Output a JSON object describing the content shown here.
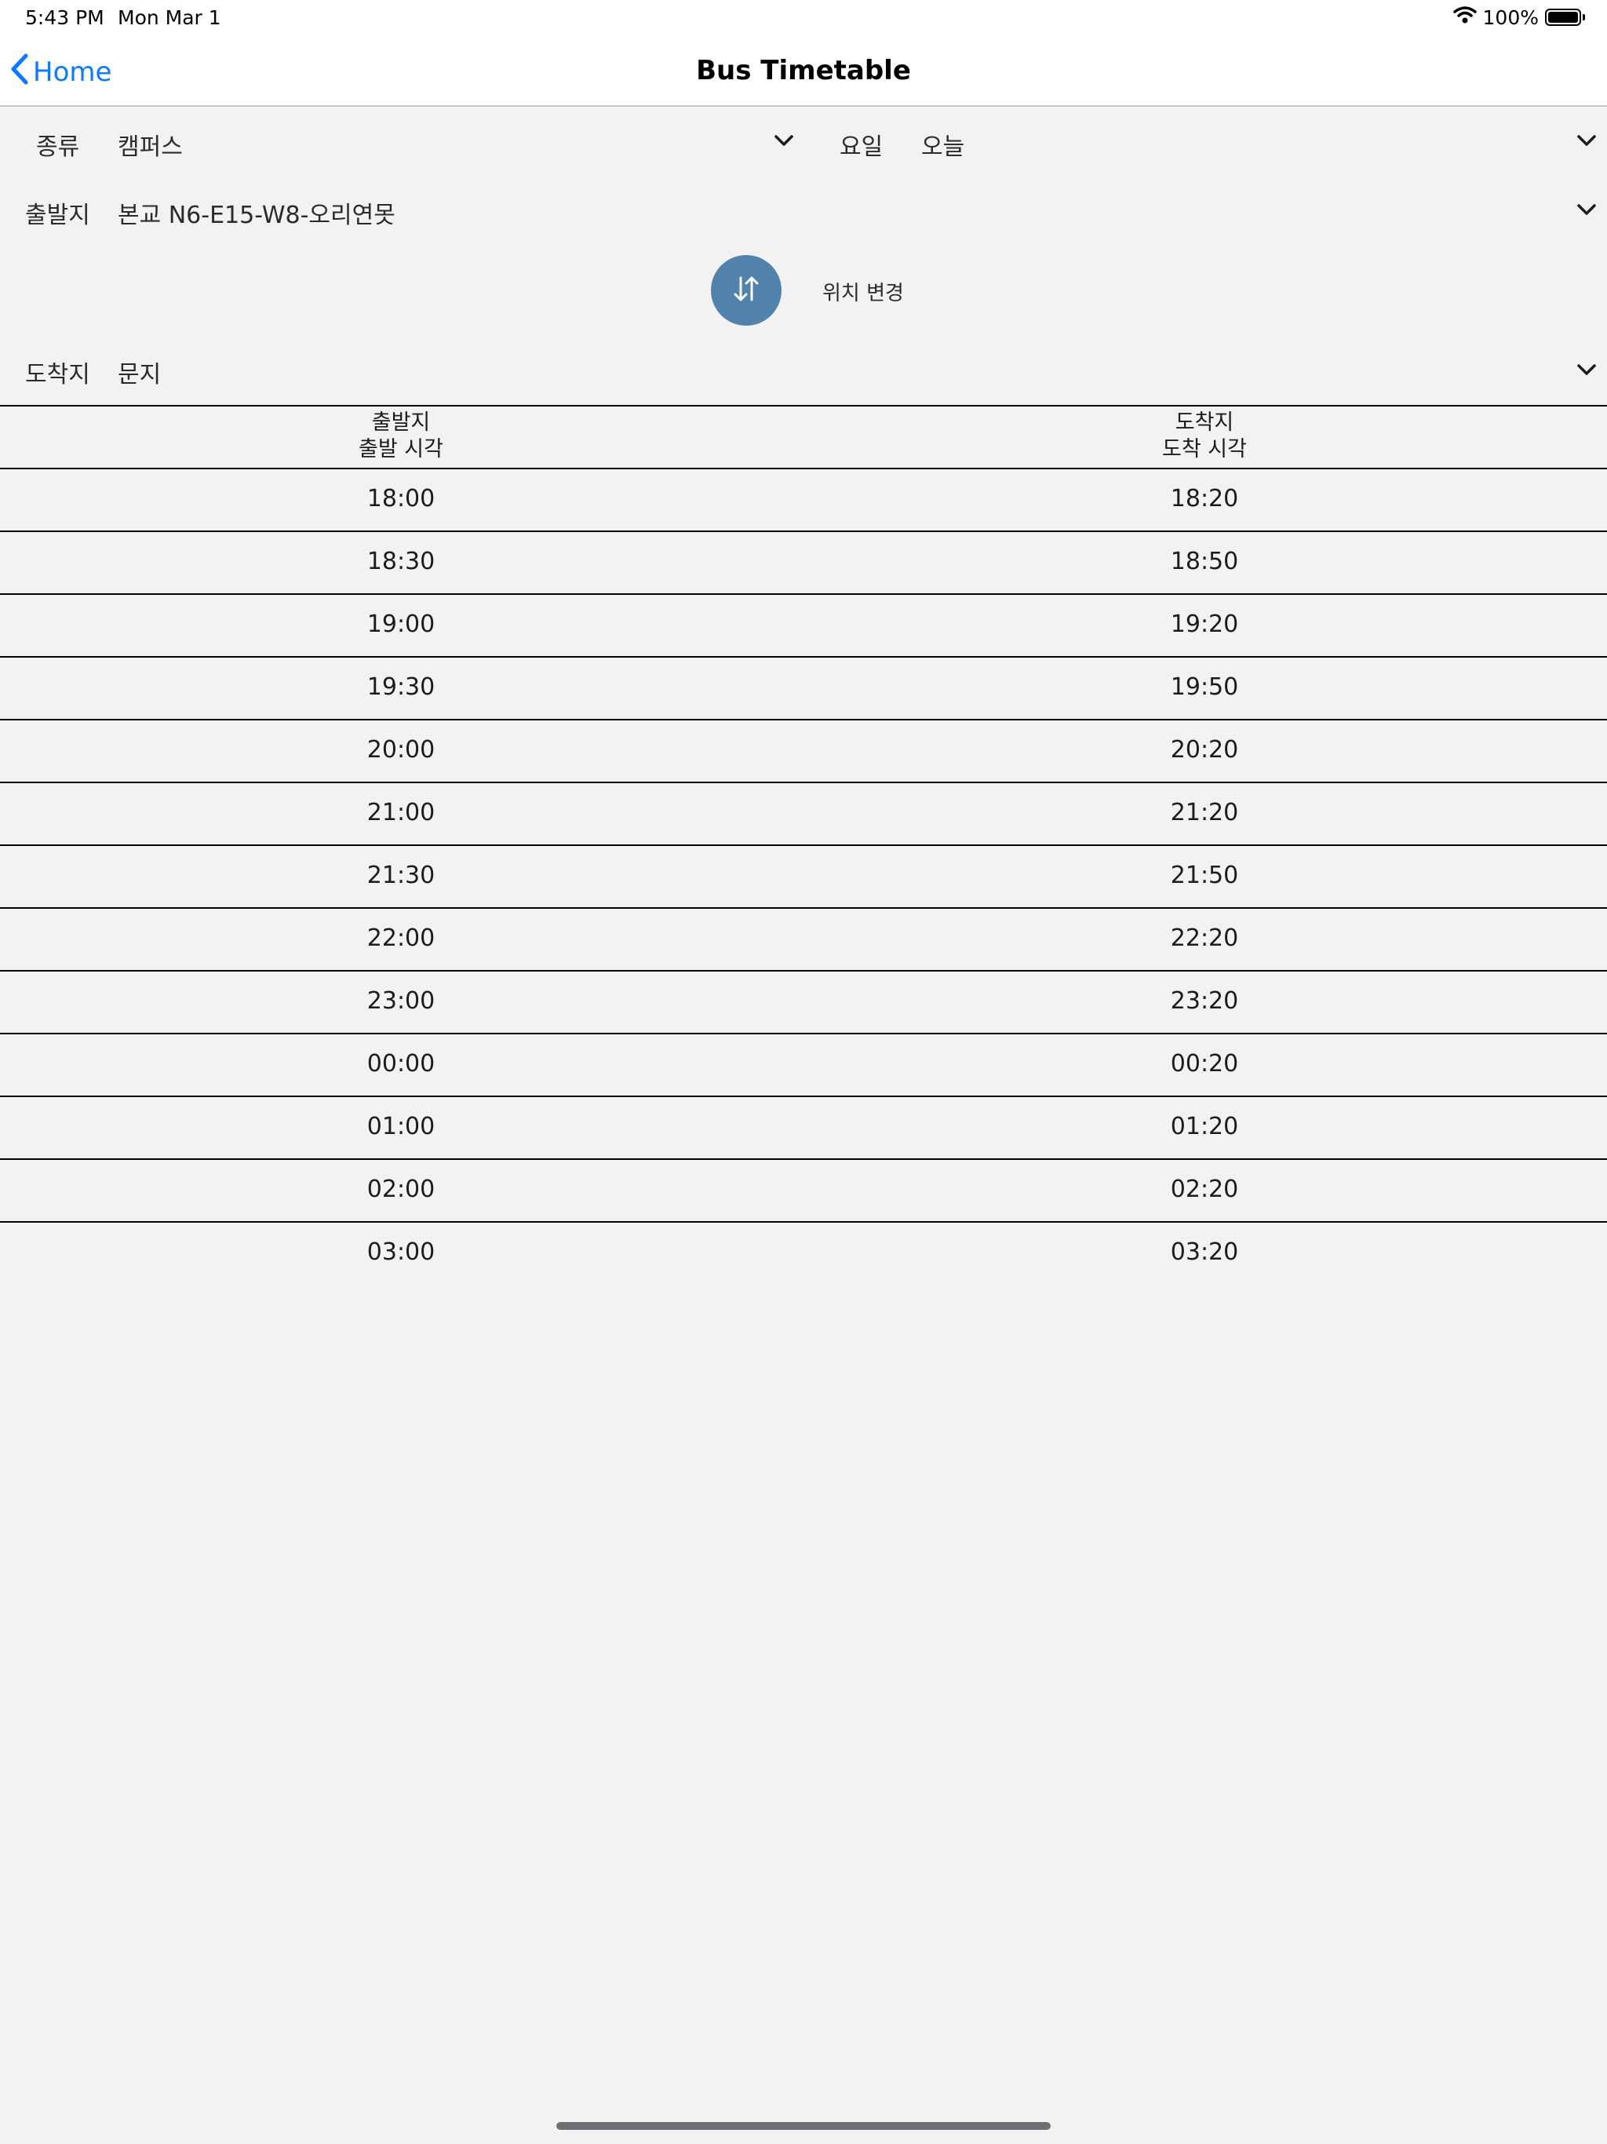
{
  "status": {
    "time": "5:43 PM",
    "date": "Mon Mar 1",
    "battery": "100%"
  },
  "nav": {
    "back_label": "Home",
    "title": "Bus Timetable"
  },
  "filters": {
    "type_label": "종류",
    "type_value": "캠퍼스",
    "day_label": "요일",
    "day_value": "오늘",
    "origin_label": "출발지",
    "origin_value": "본교 N6-E15-W8-오리연못",
    "swap_label": "위치 변경",
    "dest_label": "도착지",
    "dest_value": "문지"
  },
  "table": {
    "headers": [
      {
        "line1": "출발지",
        "line2": "출발 시각"
      },
      {
        "line1": "도착지",
        "line2": "도착 시각"
      }
    ],
    "rows": [
      [
        "18:00",
        "18:20"
      ],
      [
        "18:30",
        "18:50"
      ],
      [
        "19:00",
        "19:20"
      ],
      [
        "19:30",
        "19:50"
      ],
      [
        "20:00",
        "20:20"
      ],
      [
        "21:00",
        "21:20"
      ],
      [
        "21:30",
        "21:50"
      ],
      [
        "22:00",
        "22:20"
      ],
      [
        "23:00",
        "23:20"
      ],
      [
        "00:00",
        "00:20"
      ],
      [
        "01:00",
        "01:20"
      ],
      [
        "02:00",
        "02:20"
      ],
      [
        "03:00",
        "03:20"
      ]
    ]
  },
  "colors": {
    "accent": "#0a7aff",
    "swap_button": "#5182ab",
    "background": "#f2f2f2"
  },
  "icons": [
    "wifi-icon",
    "battery-icon",
    "back-chevron-icon",
    "chevron-down-icon",
    "swap-arrows-icon"
  ]
}
